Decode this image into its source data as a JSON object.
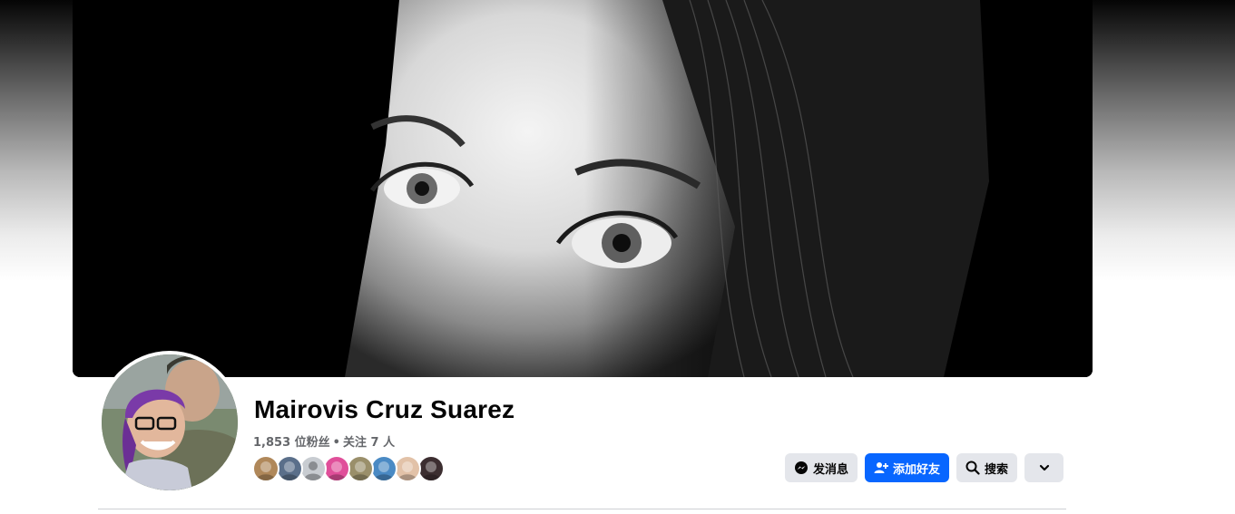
{
  "profile": {
    "name": "Mairovis Cruz Suarez",
    "followers": "1,853 位粉丝",
    "separator": "•",
    "following": "关注 7 人"
  },
  "actions": {
    "message_label": "发消息",
    "add_friend_label": "添加好友",
    "search_label": "搜索"
  },
  "icons": {
    "message": "messenger-icon",
    "add_friend": "add-person-icon",
    "search": "search-icon",
    "more": "chevron-down-icon"
  },
  "colors": {
    "primary_button": "#0866ff",
    "secondary_button": "#e4e6eb",
    "name_text": "#050505",
    "secondary_text": "#65676b"
  },
  "friend_avatars": [
    {
      "color": "#b0885a"
    },
    {
      "color": "#5a6f8a"
    },
    {
      "color": "#c8ccd1"
    },
    {
      "color": "#e04f9a"
    },
    {
      "color": "#9a8f6a"
    },
    {
      "color": "#4a8ac4"
    },
    {
      "color": "#e2c2a8"
    },
    {
      "color": "#3c2e30"
    }
  ]
}
